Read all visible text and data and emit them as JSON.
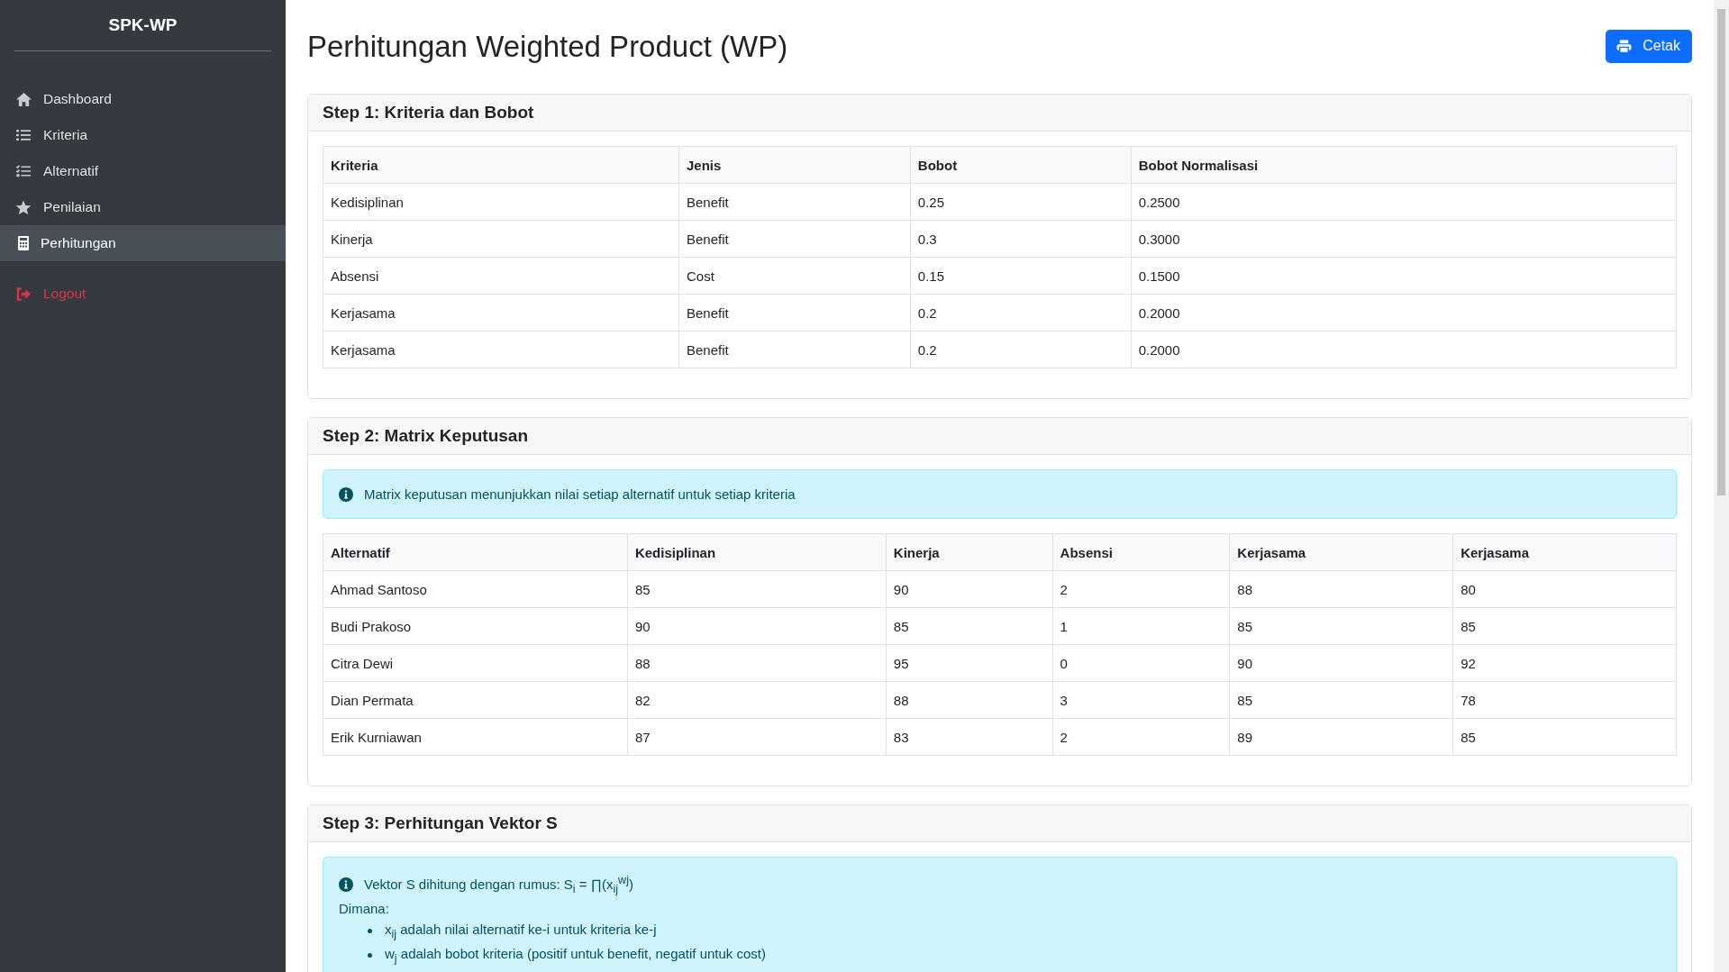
{
  "sidebar": {
    "brand": "SPK-WP",
    "items": [
      {
        "label": "Dashboard",
        "selected": false
      },
      {
        "label": "Kriteria",
        "selected": false
      },
      {
        "label": "Alternatif",
        "selected": false
      },
      {
        "label": "Penilaian",
        "selected": false
      },
      {
        "label": "Perhitungan",
        "selected": true
      }
    ],
    "logout": {
      "label": "Logout"
    }
  },
  "page": {
    "title": "Perhitungan Weighted Product (WP)",
    "print_button": "Cetak"
  },
  "steps": [
    {
      "title": "Step 1: Kriteria dan Bobot",
      "table": {
        "columns": [
          "Kriteria",
          "Jenis",
          "Bobot",
          "Bobot Normalisasi"
        ],
        "rows": [
          [
            "Kedisiplinan",
            "Benefit",
            "0.25",
            "0.2500"
          ],
          [
            "Kinerja",
            "Benefit",
            "0.3",
            "0.3000"
          ],
          [
            "Absensi",
            "Cost",
            "0.15",
            "0.1500"
          ],
          [
            "Kerjasama",
            "Benefit",
            "0.2",
            "0.2000"
          ],
          [
            "Kerjasama",
            "Benefit",
            "0.2",
            "0.2000"
          ]
        ]
      }
    },
    {
      "title": "Step 2: Matrix Keputusan",
      "alert": {
        "text": "Matrix keputusan menunjukkan nilai setiap alternatif untuk setiap kriteria"
      },
      "table": {
        "columns": [
          "Alternatif",
          "Kedisiplinan",
          "Kinerja",
          "Absensi",
          "Kerjasama",
          "Kerjasama"
        ],
        "rows": [
          [
            "Ahmad Santoso",
            "85",
            "90",
            "2",
            "88",
            "80"
          ],
          [
            "Budi Prakoso",
            "90",
            "85",
            "1",
            "85",
            "85"
          ],
          [
            "Citra Dewi",
            "88",
            "95",
            "0",
            "90",
            "92"
          ],
          [
            "Dian Permata",
            "82",
            "88",
            "3",
            "85",
            "78"
          ],
          [
            "Erik Kurniawan",
            "87",
            "83",
            "2",
            "89",
            "85"
          ]
        ]
      }
    },
    {
      "title": "Step 3: Perhitungan Vektor S",
      "alert": {
        "text": "Vektor S dihitung dengan rumus: S$_{i}$ = ∏(x$_{ij}$$^{wj}$)",
        "subtitle": "Dimana:",
        "bullets": [
          "x$_{ij}$ adalah nilai alternatif ke-i untuk kriteria ke-j",
          "w$_{j}$ adalah bobot kriteria (positif untuk benefit, negatif untuk cost)"
        ]
      }
    }
  ]
}
